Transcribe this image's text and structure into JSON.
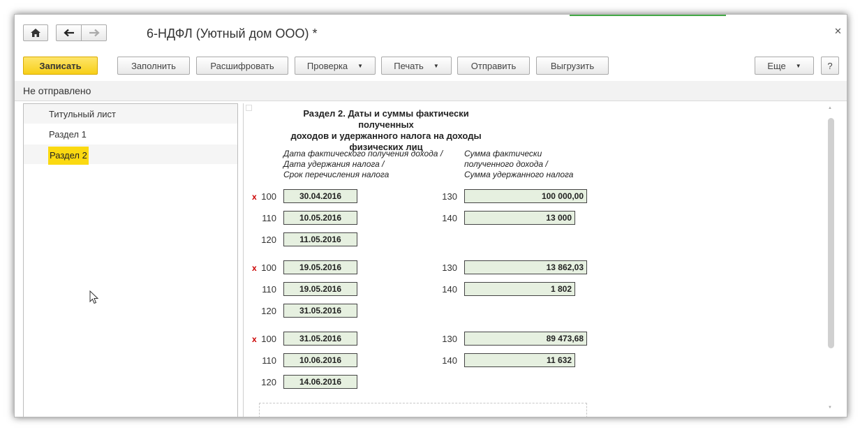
{
  "window": {
    "title": "6-НДФЛ (Уютный дом ООО) *"
  },
  "toolbar": {
    "save": "Записать",
    "fill": "Заполнить",
    "decode": "Расшифровать",
    "check": "Проверка",
    "print": "Печать",
    "send": "Отправить",
    "export": "Выгрузить",
    "more": "Еще",
    "help": "?"
  },
  "status": {
    "text": "Не отправлено"
  },
  "sidebar": {
    "items": [
      {
        "label": "Титульный лист"
      },
      {
        "label": "Раздел 1"
      },
      {
        "label": "Раздел 2"
      }
    ]
  },
  "form": {
    "title_line1": "Раздел 2.  Даты и суммы фактически полученных",
    "title_line2": "доходов и удержанного налога на доходы физических лиц",
    "col_left_1": "Дата фактического получения дохода /",
    "col_left_2": "Дата удержания налога /",
    "col_left_3": "Срок перечисления налога",
    "col_right_1": "Сумма фактически",
    "col_right_2": "полученного дохода /",
    "col_right_3": "Сумма удержанного налога",
    "marker": "x",
    "blocks": [
      {
        "code100": "100",
        "date100": "30.04.2016",
        "code130": "130",
        "amount130": "100 000,00",
        "code110": "110",
        "date110": "10.05.2016",
        "code140": "140",
        "amount140": "13 000",
        "code120": "120",
        "date120": "11.05.2016"
      },
      {
        "code100": "100",
        "date100": "19.05.2016",
        "code130": "130",
        "amount130": "13 862,03",
        "code110": "110",
        "date110": "19.05.2016",
        "code140": "140",
        "amount140": "1 802",
        "code120": "120",
        "date120": "31.05.2016"
      },
      {
        "code100": "100",
        "date100": "31.05.2016",
        "code130": "130",
        "amount130": "89 473,68",
        "code110": "110",
        "date110": "10.06.2016",
        "code140": "140",
        "amount140": "11 632",
        "code120": "120",
        "date120": "14.06.2016"
      }
    ]
  },
  "colors": {
    "accent": "#fbd911",
    "field_bg": "#e6f0e0",
    "marker": "#cc0000"
  }
}
